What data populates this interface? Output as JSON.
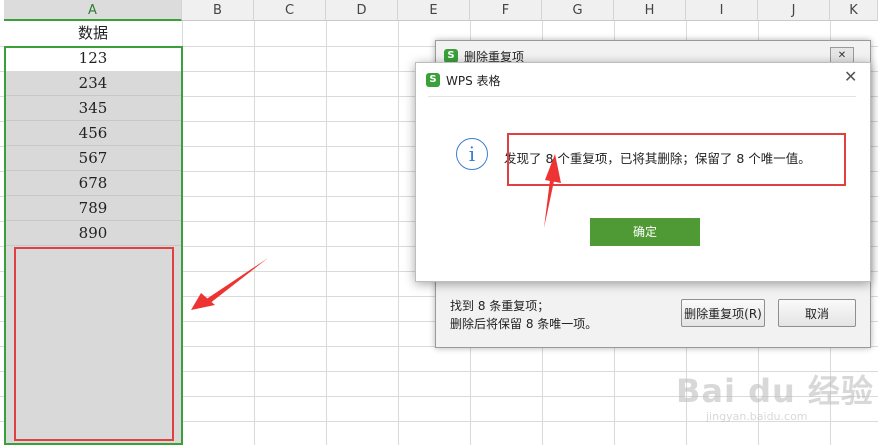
{
  "spreadsheet": {
    "columns": [
      "A",
      "B",
      "C",
      "D",
      "E",
      "F",
      "G",
      "H",
      "I",
      "J",
      "K"
    ],
    "header_cell": "数据",
    "values": [
      "123",
      "234",
      "345",
      "456",
      "567",
      "678",
      "789",
      "890"
    ]
  },
  "back_dialog": {
    "title": "删除重复项",
    "close_glyph": "✕",
    "summary_line1": "找到 8 条重复项；",
    "summary_line2": "删除后将保留 8 条唯一项。",
    "delete_button": "删除重复项(R)",
    "cancel_button": "取消"
  },
  "front_dialog": {
    "title": "WPS 表格",
    "close_glyph": "✕",
    "info_glyph": "i",
    "message": "发现了 8 个重复项，已将其删除；保留了 8 个唯一值。",
    "ok_button": "确定"
  },
  "logo_glyph": "S",
  "watermark": {
    "brand": "Bai du 经验",
    "url": "jingyan.baidu.com"
  },
  "colors": {
    "accent_green": "#3aa03a",
    "highlight_red": "#e04040",
    "ok_button": "#4f9a34",
    "info_blue": "#3a7fd0"
  }
}
